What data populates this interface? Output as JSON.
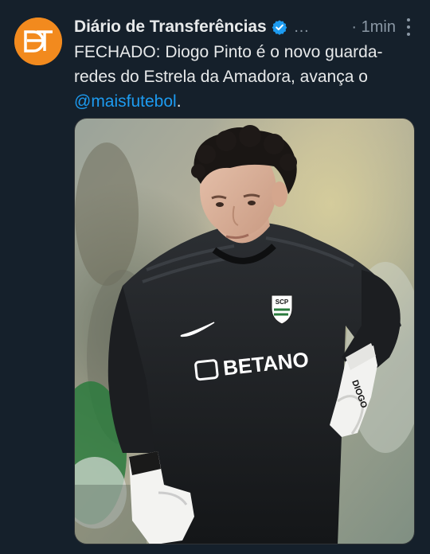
{
  "tweet": {
    "author": {
      "display_name": "Diário de Transferências",
      "avatar_initials": "DT",
      "verified": true,
      "handle_truncated": "…",
      "avatar_color": "#f28a1e"
    },
    "timestamp": "· 1min",
    "text_before": "FECHADO: Diogo Pinto é o novo guarda-redes do Estrela da Amadora, avança o ",
    "mention": "@maisfutebol",
    "text_after": ".",
    "media": {
      "alt": "Goalkeeper Diogo Pinto in black Sporting CP kit with gloves",
      "shirt_sponsor": "BETANO",
      "crest_text": "SCP",
      "glove_text": "DIOGO"
    }
  },
  "colors": {
    "background": "#15202b",
    "text_primary": "#e7e9ea",
    "text_secondary": "#8b98a5",
    "link": "#1d9bf0",
    "verified_badge": "#1d9bf0"
  },
  "icons": {
    "verified": "verified-badge-icon",
    "more": "more-options-icon"
  }
}
